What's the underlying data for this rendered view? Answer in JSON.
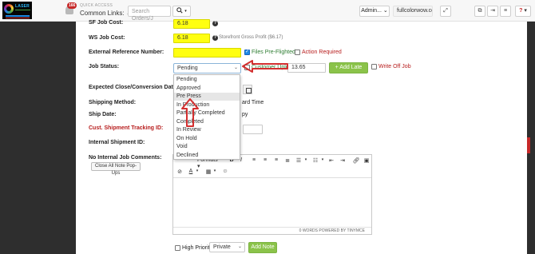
{
  "header": {
    "logo_text": "LASER",
    "notification_count": "166",
    "quick_access_label": "QUICK ACCESS",
    "common_links": "Common Links:",
    "search_placeholder": "Search Orders/J",
    "search_icon": "search-icon",
    "admin_label": "Admin...",
    "site": "fullcolorwow.com",
    "help_label": "?"
  },
  "form": {
    "sf_job_cost": {
      "label": "SF Job Cost:",
      "value": "6.18"
    },
    "ws_job_cost": {
      "label": "WS Job Cost:",
      "value": "6.18",
      "note": "Storefront Gross Profit ($6.17)"
    },
    "external_ref": {
      "label": "External Reference Number:",
      "value": "",
      "files_preflighted": "Files Pre-Flighted?",
      "action_required": "Action Required"
    },
    "job_status": {
      "label": "Job Status:",
      "selected": "Pending",
      "options": [
        "Pending",
        "Approved",
        "Pre Press",
        "In Production",
        "Partially Completed",
        "Completed",
        "In Review",
        "On Hold",
        "Void",
        "Declined"
      ],
      "highlighted": "Pre Press",
      "customer_upload_label": "Customer Upload",
      "customer_upload_value": "13.65",
      "add_late_fee": "+ Add Late Fee",
      "write_off_job": "Write Off Job"
    },
    "expected_close": {
      "label": "Expected Close/Conversion Date:"
    },
    "shipping_method": {
      "label": "Shipping Method:",
      "value_tail": "ard Time"
    },
    "ship_date": {
      "label": "Ship Date:",
      "value_tail": "py"
    },
    "cust_tracking": {
      "label": "Cust. Shipment Tracking ID:"
    },
    "internal_shipment": {
      "label": "Internal Shipment ID:"
    },
    "internal_comments": {
      "label": "No Internal Job Comments:",
      "close_popups": "Close All Note Pop-Ups",
      "formats_label": "Formats",
      "status_text": "0 WORDS POWERED BY TINYMCE"
    },
    "bottom": {
      "high_priority": "High Priority",
      "visibility": "Private",
      "add_note": "Add Note"
    }
  },
  "colors": {
    "highlight_yellow": "#ffff10",
    "accent_green": "#8bc34a",
    "annotation_red": "#d32f2f",
    "side_panel": "#2e2e2e"
  }
}
